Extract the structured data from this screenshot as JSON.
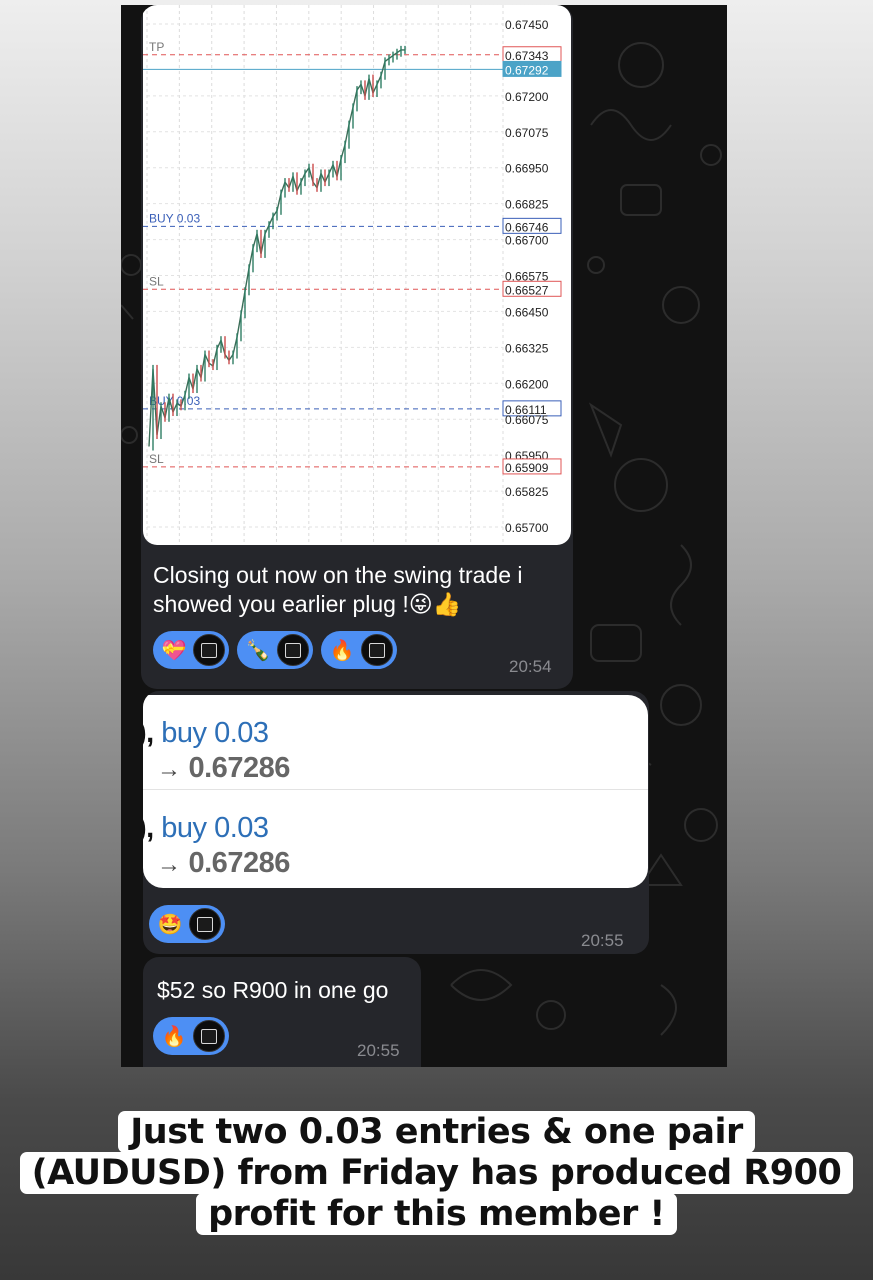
{
  "chart": {
    "price_axis": [
      "0.67450",
      "0.67343",
      "0.67292",
      "0.67200",
      "0.67075",
      "0.66950",
      "0.66825",
      "0.66746",
      "0.66700",
      "0.66575",
      "0.66527",
      "0.66450",
      "0.66325",
      "0.66200",
      "0.66111",
      "0.66075",
      "0.65950",
      "0.65909",
      "0.65825",
      "0.65700"
    ],
    "order_lines": [
      {
        "label": "TP",
        "price": "0.67343",
        "style": "dashed",
        "color": "#e05555"
      },
      {
        "label": "",
        "price": "0.67292",
        "style": "solid",
        "color": "#4ba3c7"
      },
      {
        "label": "BUY 0.03",
        "price": "0.66746",
        "style": "dashed",
        "color": "#3a5fb8"
      },
      {
        "label": "SL",
        "price": "0.66527",
        "style": "dashed",
        "color": "#e05555"
      },
      {
        "label": "BUY 0.03",
        "price": "0.66111",
        "style": "dashed",
        "color": "#3a5fb8"
      },
      {
        "label": "SL",
        "price": "0.65909",
        "style": "dashed",
        "color": "#e05555"
      }
    ]
  },
  "chart_data": {
    "type": "line",
    "title": "",
    "ylabel": "",
    "ylim": [
      0.6565,
      0.675
    ],
    "series": [
      {
        "x": [
          1,
          2,
          3,
          4,
          5,
          6,
          7,
          8,
          9,
          10,
          11,
          12,
          13,
          14,
          15,
          16,
          17,
          18,
          19,
          20,
          21,
          22,
          23,
          24,
          25,
          26,
          27,
          28,
          29,
          30,
          31,
          32,
          33,
          34,
          35,
          36,
          37,
          38,
          39,
          40,
          41,
          42,
          43,
          44,
          45,
          46,
          47,
          48,
          49,
          50,
          51,
          52,
          53,
          54,
          55,
          56,
          57,
          58,
          59,
          60,
          61,
          62,
          63,
          64,
          65
        ],
        "values": [
          0.6598,
          0.6625,
          0.6602,
          0.6612,
          0.6608,
          0.6615,
          0.661,
          0.6613,
          0.6612,
          0.6616,
          0.6622,
          0.6618,
          0.6625,
          0.6622,
          0.663,
          0.6627,
          0.6626,
          0.6632,
          0.6635,
          0.663,
          0.6628,
          0.663,
          0.6636,
          0.6644,
          0.6652,
          0.666,
          0.6667,
          0.6672,
          0.6665,
          0.6672,
          0.6675,
          0.6678,
          0.668,
          0.6686,
          0.669,
          0.6688,
          0.6692,
          0.6687,
          0.669,
          0.6693,
          0.6695,
          0.669,
          0.6688,
          0.6693,
          0.669,
          0.6693,
          0.6696,
          0.6692,
          0.6698,
          0.6703,
          0.671,
          0.6716,
          0.6722,
          0.6724,
          0.672,
          0.6726,
          0.6721,
          0.6724,
          0.6727,
          0.6732,
          0.6733,
          0.6734,
          0.6735,
          0.6736,
          0.6736
        ]
      }
    ]
  },
  "messages": [
    {
      "text": "Closing out now on the swing trade i showed you earlier plug !😜👍",
      "time": "20:54",
      "reactions": [
        "💝",
        "🍾",
        "🔥"
      ]
    },
    {
      "quotes": [
        {
          "lead": "), ",
          "action": "buy 0.03",
          "arrow": "→",
          "price": "0.67286"
        },
        {
          "lead": "), ",
          "action": "buy 0.03",
          "arrow": "→",
          "price": "0.67286"
        }
      ],
      "time": "20:55",
      "reactions": [
        "🤩"
      ]
    },
    {
      "text": "$52 so R900 in one go",
      "time": "20:55",
      "reactions": [
        "🔥"
      ]
    }
  ],
  "overlay": {
    "lines": [
      "Just two 0.03 entries & one pair",
      "(AUDUSD) from Friday has produced R900",
      "profit for this member !"
    ]
  },
  "colors": {
    "background_gradient_top": "#eeeeee",
    "background_gradient_bottom": "#383838",
    "chat_bg": "#121212",
    "bubble": "#25262b",
    "reaction_pill": "#4d8ff4",
    "candle_up": "#2e7d64",
    "candle_down": "#c94a4a"
  },
  "icons": [
    "avatar-badge",
    "arrow-right"
  ]
}
